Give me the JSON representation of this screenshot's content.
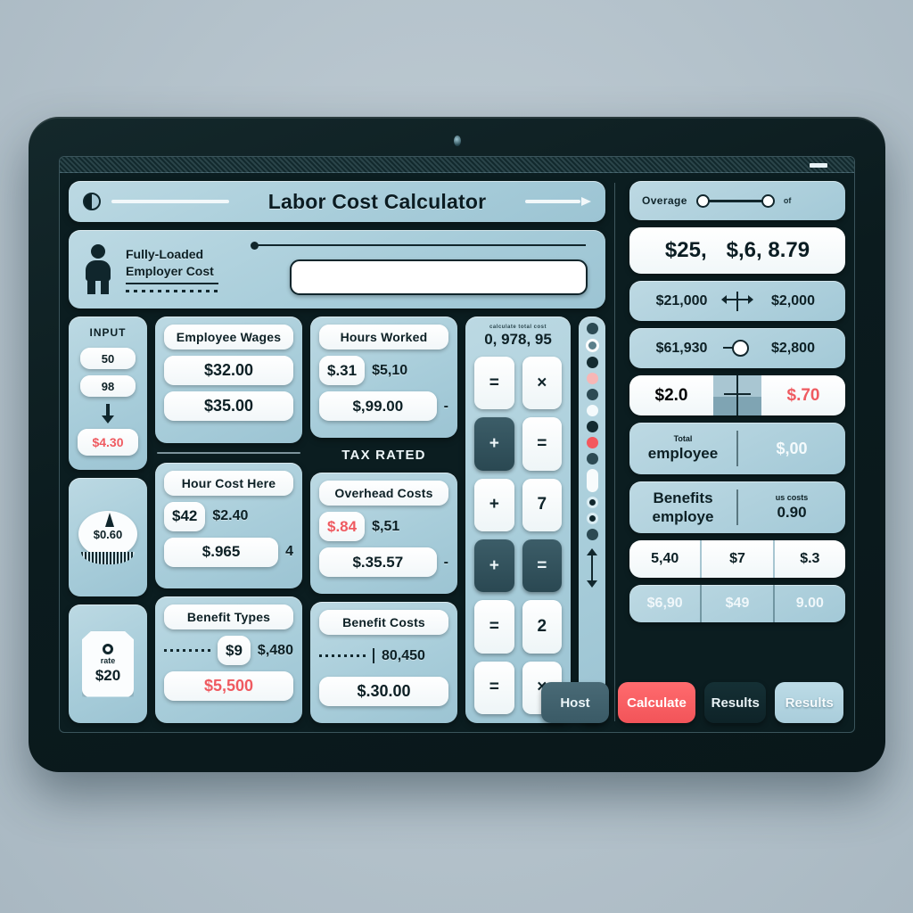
{
  "app": {
    "title": "Labor Cost Calculator"
  },
  "hero": {
    "label_line1": "Fully-Loaded",
    "label_line2": "Employer Cost",
    "field_value": "",
    "field_placeholder": ""
  },
  "rail": {
    "title": "INPUT",
    "value_1": "50",
    "value_2": "98",
    "result": "$4.30",
    "gauge_value": "$0.60",
    "tag_caption": "rate",
    "tag_value": "$20"
  },
  "cards": [
    {
      "title": "Employee Wages",
      "primary": "$32.00",
      "secondary": "$35.00",
      "tertiary": ""
    },
    {
      "title": "Hours Worked",
      "primary": "$.31",
      "primary_note": "$5,10",
      "secondary": "$,99.00",
      "secondary_note": "-"
    },
    {
      "title": "Hour Cost Here",
      "primary": "$42",
      "primary_note": "$2.40",
      "secondary": "$.965",
      "secondary_note": "4"
    },
    {
      "title": "Overhead Costs",
      "primary": "$.84",
      "primary_note": "$,51",
      "secondary": "$.35.57",
      "secondary_note": "-"
    },
    {
      "title": "Benefit Types",
      "primary": "$9",
      "primary_note": "$,480",
      "secondary": "$5,500",
      "secondary_note": ""
    },
    {
      "title": "Benefit Costs",
      "primary": "",
      "primary_note": "80,450",
      "secondary": "$.30.00",
      "secondary_note": ""
    }
  ],
  "section_label": "TAX RATED",
  "calculator": {
    "sub_label": "calculate total cost",
    "display": "0, 978, 95",
    "keys": [
      {
        "glyph": "=",
        "style": "light"
      },
      {
        "glyph": "×",
        "style": "light"
      },
      {
        "glyph": "+",
        "style": "dark"
      },
      {
        "glyph": "=",
        "style": "light"
      },
      {
        "glyph": "+",
        "style": "light"
      },
      {
        "glyph": "7",
        "style": "light"
      },
      {
        "glyph": "+",
        "style": "dark"
      },
      {
        "glyph": "=",
        "style": "dark"
      },
      {
        "glyph": "=",
        "style": "light"
      },
      {
        "glyph": "2",
        "style": "light"
      },
      {
        "glyph": "=",
        "style": "light"
      },
      {
        "glyph": "×",
        "style": "light"
      }
    ]
  },
  "indicators": [
    "dark",
    "ring",
    "darker",
    "pink",
    "dark",
    "light",
    "darker",
    "red",
    "dark",
    "tall",
    "hollow",
    "hollow",
    "dark"
  ],
  "results": {
    "slider_label": "Overage",
    "slider_sub": "of",
    "hero_left": "$25,",
    "hero_right": "$,6, 8.79",
    "rows": [
      {
        "left": "$21,000",
        "right": "$2,000",
        "mid": "arrows"
      },
      {
        "left": "$61,930",
        "right": "$2,800",
        "mid": "knob"
      }
    ],
    "split": {
      "left": "$2.0",
      "right": "$.70"
    },
    "pair_rows": [
      {
        "left_tiny": "Total",
        "left_main": "employee",
        "right_tiny": "",
        "right_main": "$,00"
      },
      {
        "left_tiny": "Benefits",
        "left_main": "employe",
        "right_tiny": "us costs",
        "right_main": "0.90"
      }
    ],
    "triple_white": [
      "5,40",
      "$7",
      "$.3"
    ],
    "triple_tint": [
      "$6,90",
      "$49",
      "9.00"
    ]
  },
  "actions": [
    {
      "label": "Host",
      "style": "slate"
    },
    {
      "label": "Calculate",
      "style": "coral"
    },
    {
      "label": "Results",
      "style": "ink"
    },
    {
      "label": "Results",
      "style": "pale"
    }
  ],
  "colors": {
    "accent_coral": "#f25459",
    "panel_blue": "#a8cdda",
    "ink": "#0b1d20"
  }
}
